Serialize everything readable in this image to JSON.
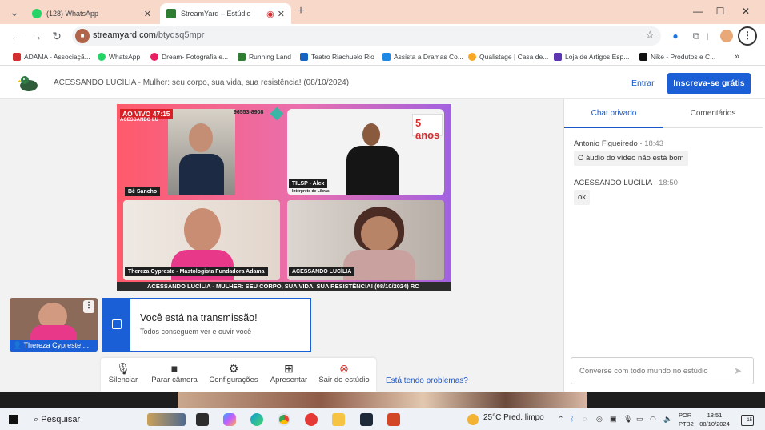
{
  "browser": {
    "tabs": [
      {
        "title": "(128) WhatsApp",
        "favicon_color": "#25d366"
      },
      {
        "title": "StreamYard – Estúdio",
        "favicon_color": "#2e7d32"
      }
    ],
    "url_host": "streamyard.com",
    "url_path": "/btydsq5mpr",
    "bookmarks": [
      {
        "label": "ADAMA - Associaçã...",
        "color": "#d32f2f"
      },
      {
        "label": "WhatsApp",
        "color": "#25d366"
      },
      {
        "label": "Dream- Fotografia e...",
        "color": "#e91e63"
      },
      {
        "label": "Running Land",
        "color": "#2e7d32"
      },
      {
        "label": "Teatro Riachuelo Rio",
        "color": "#1565c0"
      },
      {
        "label": "Assista a Dramas Co...",
        "color": "#1e88e5"
      },
      {
        "label": "Qualistage | Casa de...",
        "color": "#f9a825"
      },
      {
        "label": "Loja de Artigos Esp...",
        "color": "#5e35b1"
      },
      {
        "label": "Nike - Produtos e C...",
        "color": "#111111"
      }
    ]
  },
  "header": {
    "title": "ACESSANDO LUCÍLIA - Mulher: seu corpo, sua vida, sua resistência! (08/10/2024)",
    "login_label": "Entrar",
    "signup_label": "Inscreva-se grátis"
  },
  "stage": {
    "live_label": "AO VIVO 47:15",
    "live_sub": "ACESSANDO LU",
    "phone": "96553-8908",
    "badge_text": "5 anos",
    "feeds": [
      {
        "name": "Bê Sancho"
      },
      {
        "name": "TILSP - Alex",
        "sub": "Intérprete de Libras"
      },
      {
        "name": "Thereza Cypreste - Mastologista Fundadora Adama"
      },
      {
        "name": "ACESSANDO LUCÍLIA"
      }
    ],
    "ticker": "ACESSANDO LUCÍLIA - MULHER: SEU CORPO, SUA VIDA, SUA RESISTÊNCIA! (08/10/2024) RC"
  },
  "self_view": {
    "name": "Thereza Cypreste ..."
  },
  "notice": {
    "title": "Você está na transmissão!",
    "subtitle": "Todos conseguem ver e ouvir você"
  },
  "controls": {
    "mute": "Silenciar",
    "camera": "Parar câmera",
    "settings": "Configurações",
    "present": "Apresentar",
    "leave": "Sair do estúdio",
    "problems": "Está tendo problemas?"
  },
  "chat": {
    "tab_private": "Chat privado",
    "tab_comments": "Comentários",
    "messages": [
      {
        "author": "Antonio Figueiredo",
        "time": "18:43",
        "text": "O áudio do vídeo não está bom"
      },
      {
        "author": "ACESSANDO LUCÍLIA",
        "time": "18:50",
        "text": "ok"
      }
    ],
    "input_placeholder": "Converse com todo mundo no estúdio"
  },
  "taskbar": {
    "search_label": "Pesquisar",
    "weather": "25°C  Pred. limpo",
    "lang_1": "POR",
    "lang_2": "PTB2",
    "time": "18:51",
    "date": "08/10/2024",
    "notifications": "15"
  }
}
